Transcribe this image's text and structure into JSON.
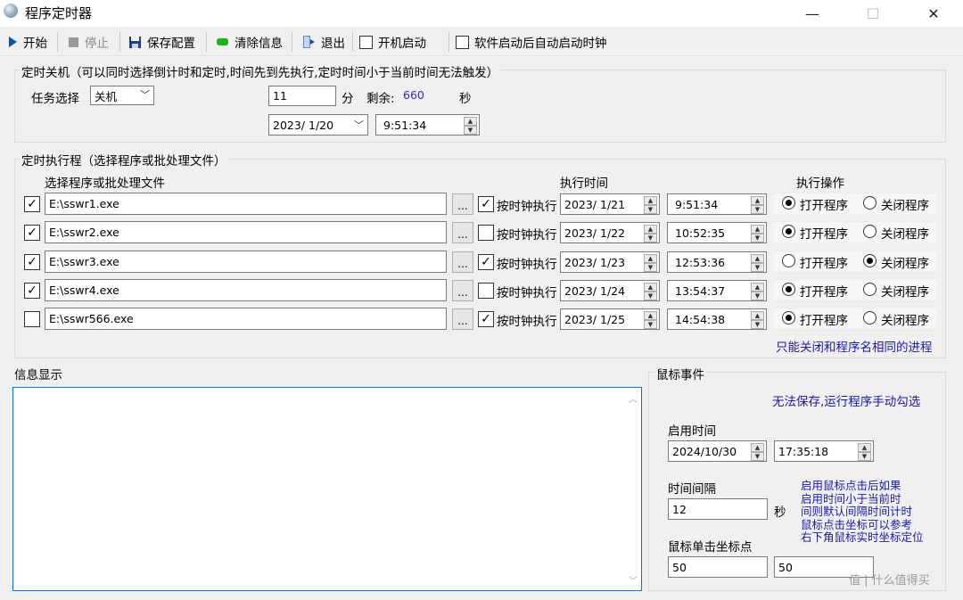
{
  "window": {
    "title": "程序定时器",
    "minimize": "—",
    "maximize": "☐",
    "close": "✕"
  },
  "toolbar": {
    "start": "开始",
    "stop": "停止",
    "save": "保存配置",
    "clear": "清除信息",
    "exit": "退出",
    "boot_start": "开机启动",
    "auto_timer": "软件启动后自动启动时钟"
  },
  "shutdown": {
    "legend": "定时关机（可以同时选择倒计时和定时,时间先到先执行,定时时间小于当前时间无法触发）",
    "task_label": "任务选择",
    "task_value": "关机",
    "minutes": "11",
    "min_unit": "分",
    "remaining_label": "剩余:",
    "remaining_value": "660",
    "sec_unit": "秒",
    "date": "2023/  1/20",
    "time": "9:51:34"
  },
  "programs": {
    "legend": "定时执行程（选择程序或批处理文件）",
    "col_file": "选择程序或批处理文件",
    "col_time": "执行时间",
    "col_action": "执行操作",
    "browse_label": "...",
    "clock_label": "按时钟执行",
    "open_label": "打开程序",
    "close_label": "关闭程序",
    "rows": [
      {
        "enabled": true,
        "path": "E:\\sswr1.exe",
        "by_clock": true,
        "date": "2023/  1/21",
        "time": "9:51:34",
        "action": "open"
      },
      {
        "enabled": true,
        "path": "E:\\sswr2.exe",
        "by_clock": false,
        "date": "2023/  1/22",
        "time": "10:52:35",
        "action": "open"
      },
      {
        "enabled": true,
        "path": "E:\\sswr3.exe",
        "by_clock": true,
        "date": "2023/  1/23",
        "time": "12:53:36",
        "action": "close"
      },
      {
        "enabled": true,
        "path": "E:\\sswr4.exe",
        "by_clock": false,
        "date": "2023/  1/24",
        "time": "13:54:37",
        "action": "open"
      },
      {
        "enabled": false,
        "path": "E:\\sswr566.exe",
        "by_clock": true,
        "date": "2023/  1/25",
        "time": "14:54:38",
        "action": "open"
      }
    ],
    "note": "只能关闭和程序名相同的进程"
  },
  "info": {
    "legend": "信息显示",
    "content": ""
  },
  "mouse": {
    "legend": "鼠标事件",
    "note": "无法保存,运行程序手动勾选",
    "start_label": "启用时间",
    "start_date": "2024/10/30",
    "start_time": "17:35:18",
    "interval_label": "时间间隔",
    "interval_value": "12",
    "interval_unit": "秒",
    "coord_label": "鼠标单击坐标点",
    "coord_x": "50",
    "coord_y": "50",
    "help": [
      "启用鼠标点击后如果",
      "启用时间小于当前时",
      "间则默认间隔时间计时",
      "鼠标点击坐标可以参考",
      "右下角鼠标实时坐标定位"
    ]
  },
  "watermark": "值 | 什么值得买",
  "colors": {
    "accent_blue": "#1a1aa8",
    "remaining_blue": "#2a2ad0"
  }
}
